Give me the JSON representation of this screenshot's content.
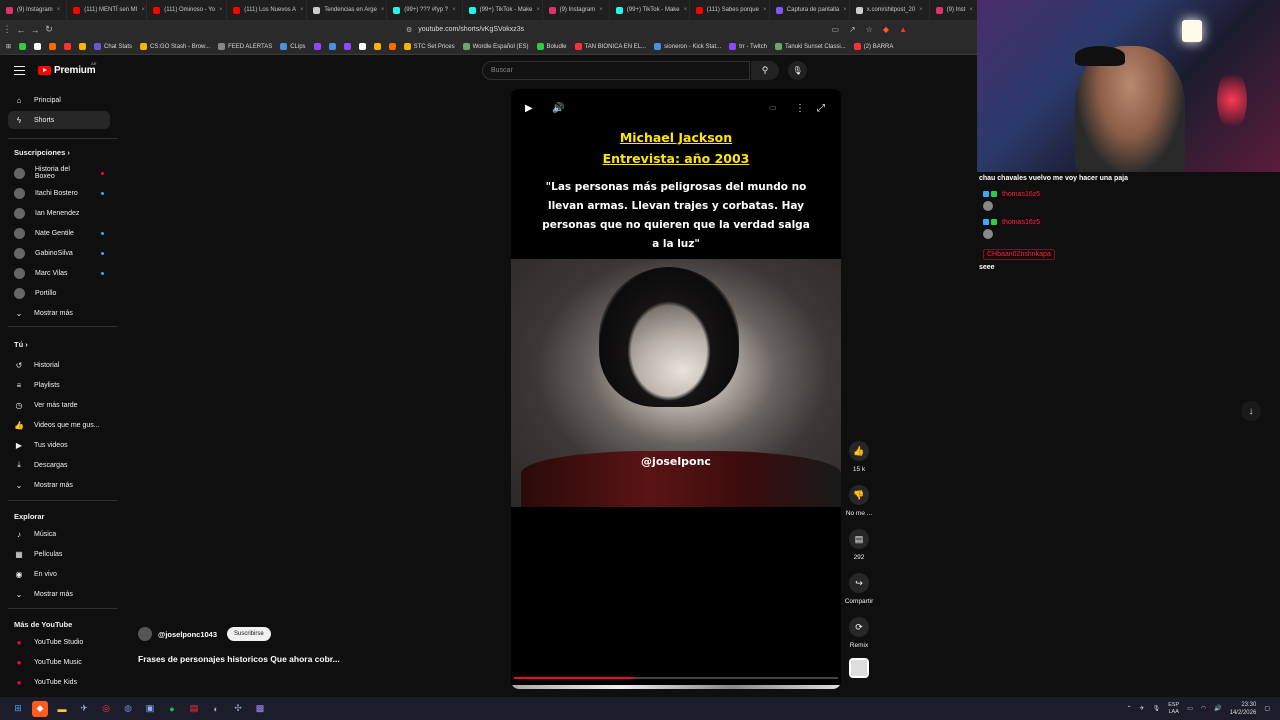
{
  "browser": {
    "tabs": [
      {
        "title": "(9) Instagram",
        "color": "#e1306c"
      },
      {
        "title": "(111) MENTÍ sen MI",
        "color": "#ff0000"
      },
      {
        "title": "(111) Ominoso - Yo",
        "color": "#ff0000"
      },
      {
        "title": "(111) Los Nuevos A",
        "color": "#ff0000"
      },
      {
        "title": "Tendencias en Arge",
        "color": "#cccccc"
      },
      {
        "title": "(99+) ??? #fyp ?",
        "color": "#25f4ee"
      },
      {
        "title": "(99+) TikTok - Make",
        "color": "#25f4ee"
      },
      {
        "title": "(9) Instagram",
        "color": "#e1306c"
      },
      {
        "title": "(99+) TikTok - Make",
        "color": "#25f4ee"
      },
      {
        "title": "(111) Sabes porque",
        "color": "#ff0000"
      },
      {
        "title": "Captura de pantalla",
        "color": "#7a5af8"
      },
      {
        "title": "x.com/shitpost_20",
        "color": "#cccccc"
      },
      {
        "title": "(9) Inst",
        "color": "#e1306c"
      }
    ],
    "url": "youtube.com/shorts/vKgSVokxz3s",
    "bookmarks": [
      {
        "label": "",
        "color": "#2ecc40"
      },
      {
        "label": "",
        "color": "#ffffff"
      },
      {
        "label": "",
        "color": "#ff6a00"
      },
      {
        "label": "",
        "color": "#ff3333"
      },
      {
        "label": "",
        "color": "#f7b500"
      },
      {
        "label": "Chat Stats",
        "color": "#6a5acd"
      },
      {
        "label": "CS:GO Stash - Brow...",
        "color": "#f7b500"
      },
      {
        "label": "FEED ALERTAS",
        "color": "#888888"
      },
      {
        "label": "CLips",
        "color": "#4a90e2"
      },
      {
        "label": "",
        "color": "#9146ff"
      },
      {
        "label": "",
        "color": "#4a90e2"
      },
      {
        "label": "",
        "color": "#9146ff"
      },
      {
        "label": "",
        "color": "#ffffff"
      },
      {
        "label": "",
        "color": "#f7b500"
      },
      {
        "label": "",
        "color": "#ff6a00"
      },
      {
        "label": "STC Set Prices",
        "color": "#f7b500"
      },
      {
        "label": "Wordle Español (ES)",
        "color": "#6aaa64"
      },
      {
        "label": "Boludle",
        "color": "#2ecc40"
      },
      {
        "label": "TAN BIONICA EN EL...",
        "color": "#ff3333"
      },
      {
        "label": "sioneron - Kick Stat...",
        "color": "#4a90e2"
      },
      {
        "label": "trr - Twitch",
        "color": "#9146ff"
      },
      {
        "label": "Tanuki Sunset Classi...",
        "color": "#6aaa64"
      },
      {
        "label": "(2) BARRA",
        "color": "#ff3333"
      }
    ]
  },
  "header": {
    "logo_text": "Premium",
    "logo_region": "AR",
    "search_placeholder": "Buscar"
  },
  "sidebar": {
    "main": [
      {
        "label": "Principal",
        "icon": "home-icon",
        "glyph": "⌂"
      },
      {
        "label": "Shorts",
        "icon": "shorts-icon",
        "glyph": "ϟ",
        "active": true
      }
    ],
    "subs_title": "Suscripciones",
    "subs": [
      {
        "label": "Historia del Boxeo",
        "live": true,
        "live_color": "#ff0033"
      },
      {
        "label": "Itachi Bostero",
        "live": true,
        "live_color": "#3ea6ff"
      },
      {
        "label": "Ian Menendez",
        "live": false
      },
      {
        "label": "Nate Gentile",
        "live": true,
        "live_color": "#3ea6ff"
      },
      {
        "label": "GabinoSilva",
        "live": true,
        "live_color": "#3ea6ff"
      },
      {
        "label": "Marc Vilas",
        "live": true,
        "live_color": "#3ea6ff"
      },
      {
        "label": "Portillo",
        "live": false
      },
      {
        "label": "Mostrar más",
        "icon": "chevron-down-icon"
      }
    ],
    "you_title": "Tú",
    "you": [
      {
        "label": "Historial",
        "icon": "history-icon",
        "glyph": "↺"
      },
      {
        "label": "Playlists",
        "icon": "playlists-icon",
        "glyph": "≡"
      },
      {
        "label": "Ver más tarde",
        "icon": "clock-icon",
        "glyph": "◷"
      },
      {
        "label": "Videos que me gus...",
        "icon": "like-icon",
        "glyph": "👍"
      },
      {
        "label": "Tus videos",
        "icon": "your-videos-icon",
        "glyph": "▶"
      },
      {
        "label": "Descargas",
        "icon": "download-icon",
        "glyph": "⤓"
      },
      {
        "label": "Mostrar más",
        "icon": "chevron-down-icon",
        "glyph": "⌄"
      }
    ],
    "explore_title": "Explorar",
    "explore": [
      {
        "label": "Música",
        "icon": "music-icon",
        "glyph": "♪"
      },
      {
        "label": "Películas",
        "icon": "movies-icon",
        "glyph": "▦"
      },
      {
        "label": "En vivo",
        "icon": "live-icon",
        "glyph": "◉"
      },
      {
        "label": "Mostrar más",
        "icon": "chevron-down-icon",
        "glyph": "⌄"
      }
    ],
    "more_title": "Más de YouTube",
    "more": [
      {
        "label": "YouTube Studio"
      },
      {
        "label": "YouTube Music"
      },
      {
        "label": "YouTube Kids"
      }
    ]
  },
  "short": {
    "title_line1": "Michael Jackson",
    "title_line2": "Entrevista: año 2003",
    "quote": "\"Las personas más peligrosas del mundo no llevan armas. Llevan trajes y corbatas. Hay personas que no quieren que la verdad salga a la luz\"",
    "watermark": "@joselponc",
    "progress": 0.37
  },
  "actions": {
    "likes": "15 k",
    "dislike": "No me ...",
    "comments": "292",
    "share": "Compartir",
    "remix": "Remix"
  },
  "channel": {
    "handle": "@joselponc1043",
    "subscribe": "Suscribirse",
    "video_title": "Frases de personajes historicos Que ahora cobr..."
  },
  "chat": {
    "line1": "chau chavales vuelvo me voy hacer una paja",
    "user1": "thomas16z5",
    "user2": "thomas16z5",
    "user3": "CHbaan02nshnkapa",
    "message": "seee"
  },
  "taskbar": {
    "lang_top": "ESP",
    "lang_bottom": "LAA",
    "time": "23:30",
    "date": "14/2/2026"
  }
}
